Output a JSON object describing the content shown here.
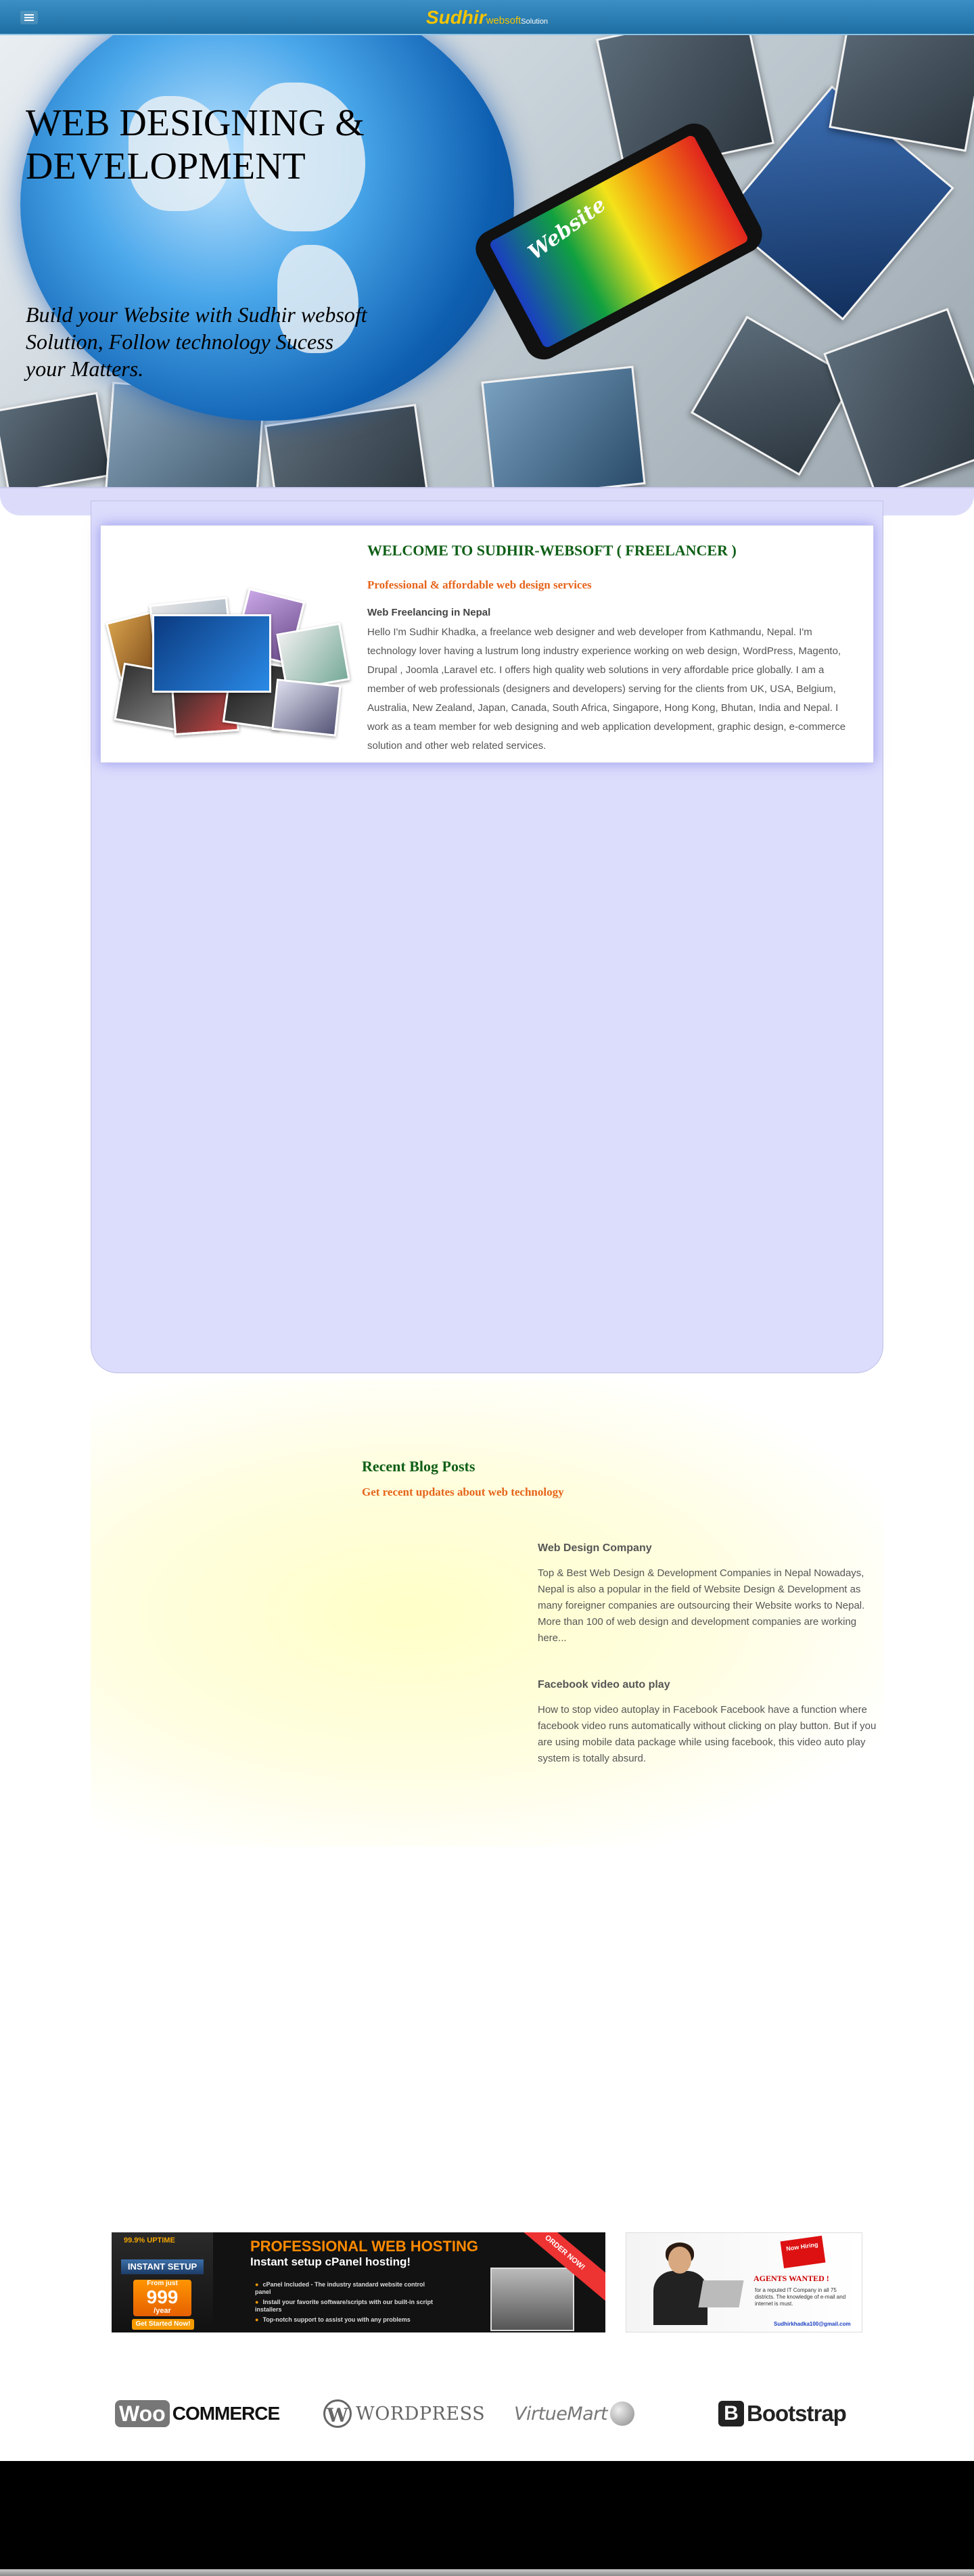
{
  "header": {
    "logo_part1": "Sudhir",
    "logo_part2": "websoft",
    "logo_part3": "Solution"
  },
  "hero": {
    "title": "WEB DESIGNING & DEVELOPMENT",
    "subtitle": "Build your Website with Sudhir websoft Solution, Follow technology Sucess your Matters.",
    "phone_text": "Website"
  },
  "welcome": {
    "title": "WELCOME TO SUDHIR-WEBSOFT ( FREELANCER )",
    "subtitle": "Professional & affordable web design services",
    "heading": "Web Freelancing in Nepal",
    "body": "Hello I'm Sudhir Khadka, a freelance web designer and web developer from Kathmandu, Nepal. I'm technology lover having a lustrum long industry experience working on web design, WordPress, Magento, Drupal , Joomla ,Laravel etc. I offers high quality web solutions in very affordable price globally. I am a member of web professionals (designers and developers) serving for the clients from UK, USA, Belgium, Australia, New Zealand, Japan, Canada, South Africa, Singapore, Hong Kong, Bhutan, India and Nepal. I work as a team member for web designing and web application development, graphic design, e-commerce solution and other web related services."
  },
  "blog": {
    "title": "Recent Blog Posts",
    "subtitle": "Get recent updates about web technology",
    "posts": [
      {
        "title": "Web Design Company",
        "excerpt": "Top & Best Web Design & Development Companies in Nepal Nowadays, Nepal is also a popular in the field of Website Design & Development as many foreigner companies are outsourcing their Website works to Nepal. More than 100 of web design and development companies are working here..."
      },
      {
        "title": "Facebook video auto play",
        "excerpt": "How to stop video autoplay in Facebook Facebook have a function where facebook video runs automatically without clicking on play button. But if you are using mobile data package while using facebook, this video auto play system is totally absurd."
      }
    ]
  },
  "ads": {
    "hosting": {
      "uptime": "99.9% UPTIME",
      "setup": "INSTANT SETUP",
      "from": "From just",
      "price": "999",
      "per": "/year",
      "button": "Get Started Now!",
      "headline": "PROFESSIONAL WEB HOSTING",
      "subline": "Instant setup cPanel hosting!",
      "features": [
        "cPanel Included - The industry standard website control panel",
        "Install your favorite software/scripts with our built-in script installers",
        "Top-notch support to assist you with any problems"
      ],
      "ribbon": "ORDER NOW!"
    },
    "agents": {
      "badge": "Now Hiring",
      "title": "AGENTS WANTED !",
      "text": "for a reputed IT Company in all 75 districts. The knowledge of e-mail and internet is must.",
      "email": "Sudhirkhadka100@gmail.com"
    }
  },
  "partners": {
    "woo_box": "Woo",
    "woo_text": "COMMERCE",
    "wp_icon": "W",
    "wp_text": "WORDPRESS",
    "vm_text": "VirtueMart",
    "bs_icon": "B",
    "bs_text": "Bootstrap"
  }
}
